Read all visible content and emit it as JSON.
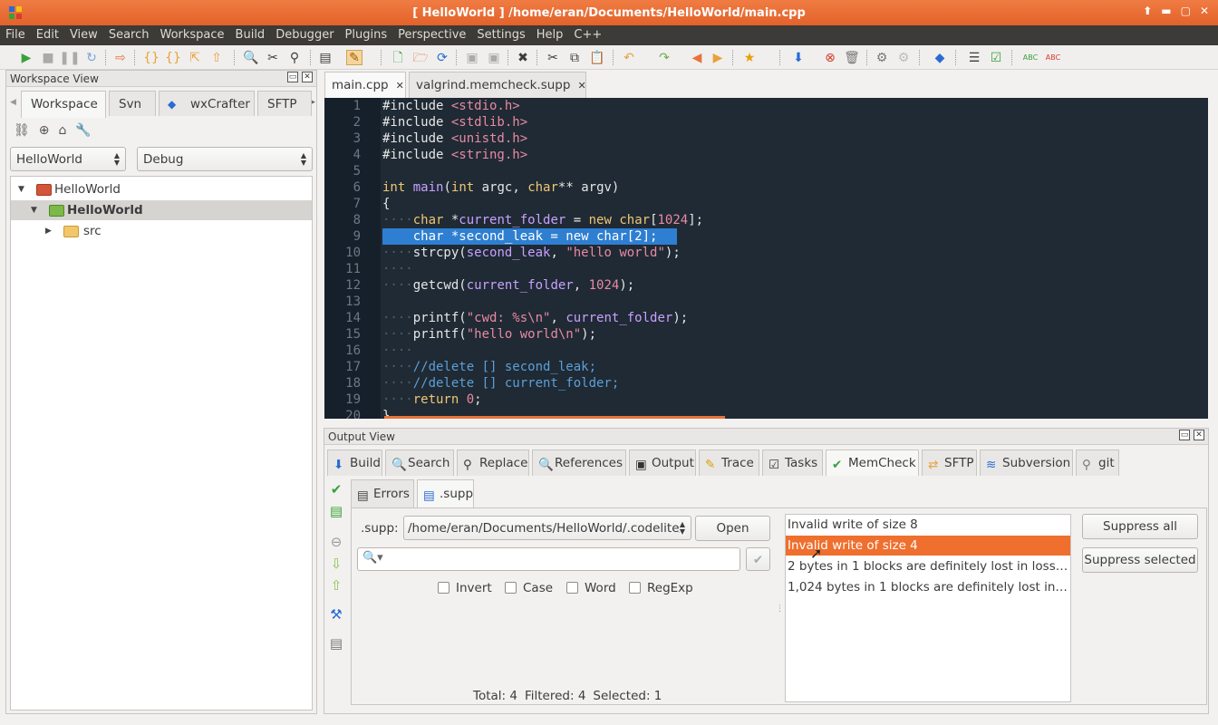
{
  "window": {
    "title": "[ HelloWorld ] /home/eran/Documents/HelloWorld/main.cpp"
  },
  "menu": [
    "File",
    "Edit",
    "View",
    "Search",
    "Workspace",
    "Build",
    "Debugger",
    "Plugins",
    "Perspective",
    "Settings",
    "Help",
    "C++"
  ],
  "workspace": {
    "title": "Workspace View",
    "tabs": [
      "Workspace",
      "Svn",
      "wxCrafter",
      "SFTP"
    ],
    "project_combo": "HelloWorld",
    "config_combo": "Debug",
    "tree": {
      "root": "HelloWorld",
      "project": "HelloWorld",
      "folder": "src"
    }
  },
  "editor": {
    "tabs": [
      "main.cpp",
      "valgrind.memcheck.supp"
    ],
    "line_numbers": [
      "1",
      "2",
      "3",
      "4",
      "5",
      "6",
      "7",
      "8",
      "9",
      "10",
      "11",
      "12",
      "13",
      "14",
      "15",
      "16",
      "17",
      "18",
      "19",
      "20"
    ],
    "selected_line": 9
  },
  "output": {
    "title": "Output View",
    "tabs": [
      "Build",
      "Search",
      "Replace",
      "References",
      "Output",
      "Trace",
      "Tasks",
      "MemCheck",
      "SFTP",
      "Subversion",
      "git"
    ],
    "active_tab": "MemCheck",
    "memcheck": {
      "subtabs": [
        "Errors",
        ".supp"
      ],
      "supp_label": ".supp:",
      "supp_path": "/home/eran/Documents/HelloWorld/.codelite/",
      "open_button": "Open",
      "search_placeholder": "",
      "options": [
        "Invert",
        "Case",
        "Word",
        "RegExp"
      ],
      "status": {
        "total": "Total: 4",
        "filtered": "Filtered: 4",
        "selected": "Selected: 1"
      },
      "errors": [
        "Invalid write of size 8",
        "Invalid write of size 4",
        "2 bytes in 1 blocks are definitely lost in loss r...",
        "1,024 bytes in 1 blocks are definitely lost in l..."
      ],
      "selected_error": 1,
      "suppress_all": "Suppress all",
      "suppress_selected": "Suppress selected"
    }
  },
  "colors": {
    "accent": "#e8743b",
    "editor_bg": "#1f2a34",
    "selection": "#2e7fd1"
  }
}
